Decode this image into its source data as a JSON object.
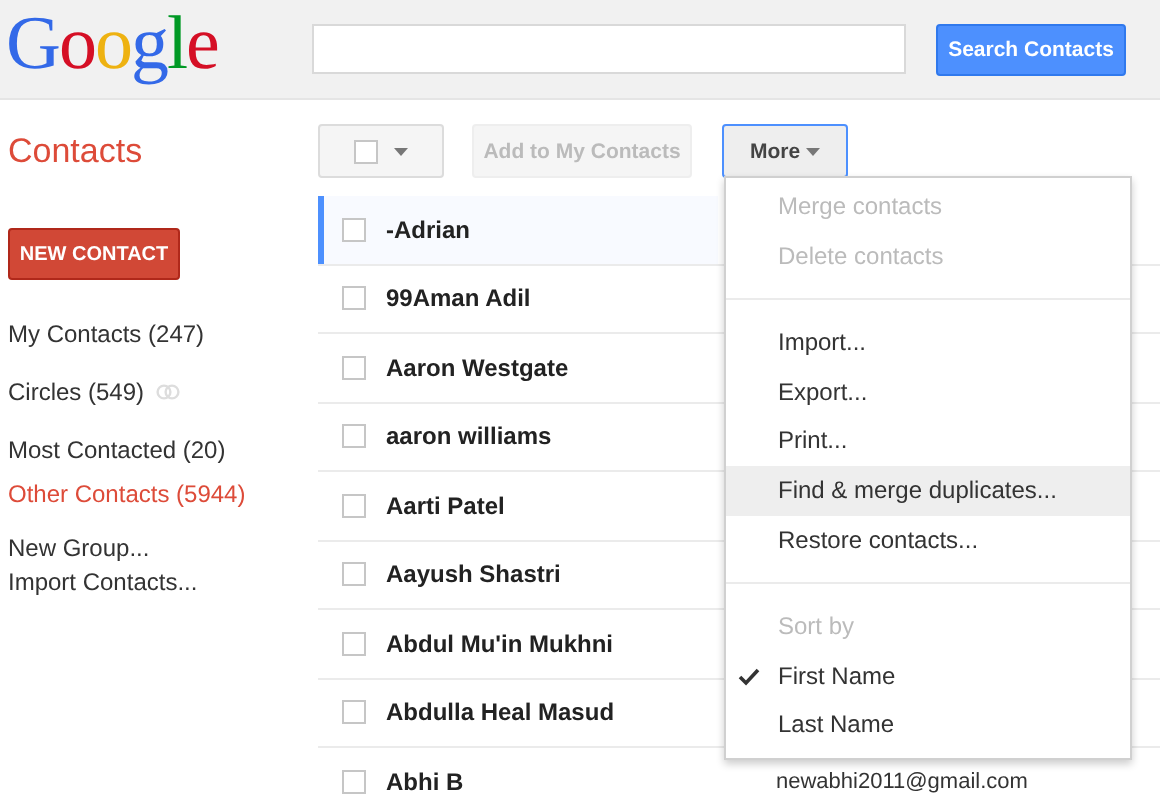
{
  "header": {
    "logo": "Google",
    "search_button": "Search Contacts"
  },
  "title": "Contacts",
  "toolbar": {
    "select_checked": false,
    "add_button": {
      "label": "Add to My Contacts",
      "disabled": true
    },
    "more_button": {
      "label": "More",
      "expanded": true
    }
  },
  "sidebar": {
    "new_contact": "NEW CONTACT",
    "groups": [
      {
        "label": "My Contacts (247)",
        "selected": false,
        "kind": "plain"
      },
      {
        "label": "Circles (549)",
        "selected": false,
        "kind": "circles"
      },
      {
        "label": "Most Contacted (20)",
        "selected": false,
        "kind": "plain"
      },
      {
        "label": "Other Contacts (5944)",
        "selected": true,
        "kind": "plain"
      }
    ],
    "links": [
      "New Group...",
      "Import Contacts..."
    ]
  },
  "contacts": [
    {
      "name": "-Adrian",
      "selected": true,
      "checked": false
    },
    {
      "name": "99Aman Adil",
      "selected": false,
      "checked": false
    },
    {
      "name": "Aaron Westgate",
      "selected": false,
      "checked": false
    },
    {
      "name": "aaron williams",
      "selected": false,
      "checked": false
    },
    {
      "name": "Aarti Patel",
      "selected": false,
      "checked": false
    },
    {
      "name": "Aayush Shastri",
      "selected": false,
      "checked": false
    },
    {
      "name": "Abdul Mu'in Mukhni",
      "selected": false,
      "checked": false
    },
    {
      "name": "Abdulla Heal Masud",
      "selected": false,
      "checked": false
    },
    {
      "name": "Abhi B",
      "selected": false,
      "checked": false,
      "email": "newabhi2011@gmail.com"
    }
  ],
  "more_menu": [
    {
      "kind": "item",
      "label": "Merge contacts",
      "disabled": true,
      "highlighted": false
    },
    {
      "kind": "item",
      "label": "Delete contacts",
      "disabled": true,
      "highlighted": false
    },
    {
      "kind": "separator"
    },
    {
      "kind": "item",
      "label": "Import...",
      "disabled": false,
      "highlighted": false
    },
    {
      "kind": "item",
      "label": "Export...",
      "disabled": false,
      "highlighted": false
    },
    {
      "kind": "item",
      "label": "Print...",
      "disabled": false,
      "highlighted": false
    },
    {
      "kind": "item",
      "label": "Find & merge duplicates...",
      "disabled": false,
      "highlighted": true
    },
    {
      "kind": "item",
      "label": "Restore contacts...",
      "disabled": false,
      "highlighted": false
    },
    {
      "kind": "separator"
    },
    {
      "kind": "header",
      "label": "Sort by"
    },
    {
      "kind": "option",
      "label": "First Name",
      "checked": true
    },
    {
      "kind": "option",
      "label": "Last Name",
      "checked": false
    }
  ]
}
